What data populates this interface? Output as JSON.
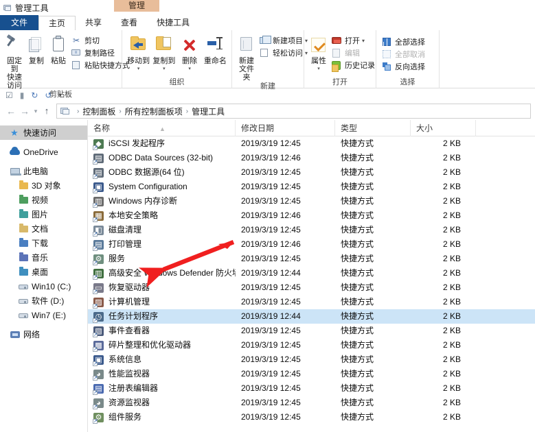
{
  "window": {
    "title": "管理工具",
    "contextual_tab": "管理"
  },
  "tabs": [
    {
      "id": "file",
      "label": "文件"
    },
    {
      "id": "home",
      "label": "主页"
    },
    {
      "id": "share",
      "label": "共享"
    },
    {
      "id": "view",
      "label": "查看"
    },
    {
      "id": "tools",
      "label": "快捷工具"
    }
  ],
  "ribbon": {
    "groups": [
      {
        "id": "clipboard",
        "label": "剪贴板",
        "big": [
          {
            "id": "pin-to-quick-access",
            "label": "固定到\n快速访问",
            "icon": "pin-icon"
          },
          {
            "id": "copy",
            "label": "复制",
            "icon": "copy-icon"
          },
          {
            "id": "paste",
            "label": "粘贴",
            "icon": "paste-icon"
          }
        ],
        "small": [
          {
            "id": "cut",
            "label": "剪切",
            "icon": "scissors-icon"
          },
          {
            "id": "copy-path",
            "label": "复制路径",
            "icon": "copy-path-icon"
          },
          {
            "id": "paste-shortcut",
            "label": "粘贴快捷方式",
            "icon": "paste-shortcut-icon"
          }
        ]
      },
      {
        "id": "organize",
        "label": "组织",
        "big": [
          {
            "id": "move-to",
            "label": "移动到",
            "icon": "move-to-icon",
            "dropdown": true
          },
          {
            "id": "copy-to",
            "label": "复制到",
            "icon": "copy-to-icon",
            "dropdown": true
          },
          {
            "id": "delete",
            "label": "删除",
            "icon": "delete-icon",
            "dropdown": true
          },
          {
            "id": "rename",
            "label": "重命名",
            "icon": "rename-icon"
          }
        ]
      },
      {
        "id": "new",
        "label": "新建",
        "big": [
          {
            "id": "new-folder",
            "label": "新建\n文件夹",
            "icon": "new-folder-icon"
          }
        ],
        "small": [
          {
            "id": "new-item",
            "label": "新建项目",
            "icon": "new-item-icon",
            "dropdown": true
          },
          {
            "id": "easy-access",
            "label": "轻松访问",
            "icon": "easy-access-icon",
            "dropdown": true
          }
        ]
      },
      {
        "id": "open",
        "label": "打开",
        "big": [
          {
            "id": "properties",
            "label": "属性",
            "icon": "properties-icon",
            "dropdown": true
          }
        ],
        "small": [
          {
            "id": "open",
            "label": "打开",
            "icon": "open-icon",
            "dropdown": true
          },
          {
            "id": "edit",
            "label": "编辑",
            "icon": "edit-icon",
            "disabled": true
          },
          {
            "id": "history",
            "label": "历史记录",
            "icon": "history-icon"
          }
        ]
      },
      {
        "id": "select",
        "label": "选择",
        "small": [
          {
            "id": "select-all",
            "label": "全部选择",
            "icon": "select-all-icon"
          },
          {
            "id": "select-none",
            "label": "全部取消",
            "icon": "select-none-icon",
            "disabled": true
          },
          {
            "id": "invert-selection",
            "label": "反向选择",
            "icon": "invert-selection-icon"
          }
        ]
      }
    ]
  },
  "quick_access_toolbar": {
    "items": [
      {
        "id": "properties",
        "icon": "properties-small-icon"
      },
      {
        "id": "new-folder",
        "icon": "new-folder-small-icon"
      },
      {
        "id": "redo",
        "icon": "redo-icon"
      },
      {
        "id": "undo",
        "icon": "undo-icon"
      },
      {
        "id": "customize",
        "icon": "chevron-down-icon"
      }
    ]
  },
  "navigation": {
    "back": "←",
    "forward": "→",
    "recent": "⌄",
    "up": "↑",
    "breadcrumbs": [
      "控制面板",
      "所有控制面板项",
      "管理工具"
    ],
    "separator": "›"
  },
  "sidebar": {
    "items": [
      {
        "id": "quick-access",
        "label": "快速访问",
        "icon": "star-icon",
        "indent": false,
        "selected": true
      },
      {
        "id": "gap1",
        "type": "gap"
      },
      {
        "id": "onedrive",
        "label": "OneDrive",
        "icon": "cloud-icon",
        "indent": false
      },
      {
        "id": "gap2",
        "type": "gap"
      },
      {
        "id": "this-pc",
        "label": "此电脑",
        "icon": "pc-icon",
        "indent": false
      },
      {
        "id": "3d-objects",
        "label": "3D 对象",
        "icon": "folder-yellow-icon",
        "indent": true
      },
      {
        "id": "videos",
        "label": "视频",
        "icon": "folder-green-icon",
        "indent": true
      },
      {
        "id": "pictures",
        "label": "图片",
        "icon": "folder-teal-icon",
        "indent": true
      },
      {
        "id": "documents",
        "label": "文档",
        "icon": "folder-gold-icon",
        "indent": true
      },
      {
        "id": "downloads",
        "label": "下载",
        "icon": "folder-blue-icon",
        "indent": true
      },
      {
        "id": "music",
        "label": "音乐",
        "icon": "folder-music-icon",
        "indent": true
      },
      {
        "id": "desktop",
        "label": "桌面",
        "icon": "folder-desktop-icon",
        "indent": true
      },
      {
        "id": "win10-c",
        "label": "Win10 (C:)",
        "icon": "drive-windows-icon",
        "indent": true
      },
      {
        "id": "software-d",
        "label": "软件 (D:)",
        "icon": "drive-icon",
        "indent": true
      },
      {
        "id": "win7-e",
        "label": "Win7 (E:)",
        "icon": "drive-icon",
        "indent": true
      },
      {
        "id": "gap3",
        "type": "gap"
      },
      {
        "id": "network",
        "label": "网络",
        "icon": "network-icon",
        "indent": false
      }
    ]
  },
  "file_list": {
    "columns": [
      {
        "id": "name",
        "label": "名称",
        "sorted": true
      },
      {
        "id": "date",
        "label": "修改日期"
      },
      {
        "id": "type",
        "label": "类型"
      },
      {
        "id": "size",
        "label": "大小"
      }
    ],
    "rows": [
      {
        "name": "iSCSI 发起程序",
        "date": "2019/3/19 12:45",
        "type": "快捷方式",
        "size": "2 KB",
        "icon_color": "#4d7a52",
        "glyph": "◆"
      },
      {
        "name": "ODBC Data Sources (32-bit)",
        "date": "2019/3/19 12:46",
        "type": "快捷方式",
        "size": "2 KB",
        "icon_color": "#5f6b78",
        "glyph": "▤"
      },
      {
        "name": "ODBC 数据源(64 位)",
        "date": "2019/3/19 12:45",
        "type": "快捷方式",
        "size": "2 KB",
        "icon_color": "#5f6b78",
        "glyph": "▤"
      },
      {
        "name": "System Configuration",
        "date": "2019/3/19 12:45",
        "type": "快捷方式",
        "size": "2 KB",
        "icon_color": "#3b5a8c",
        "glyph": "▣"
      },
      {
        "name": "Windows 内存诊断",
        "date": "2019/3/19 12:45",
        "type": "快捷方式",
        "size": "2 KB",
        "icon_color": "#6b6b6b",
        "glyph": "▥"
      },
      {
        "name": "本地安全策略",
        "date": "2019/3/19 12:46",
        "type": "快捷方式",
        "size": "2 KB",
        "icon_color": "#8a6b3a",
        "glyph": "▦"
      },
      {
        "name": "磁盘清理",
        "date": "2019/3/19 12:45",
        "type": "快捷方式",
        "size": "2 KB",
        "icon_color": "#7a8a99",
        "glyph": "◧"
      },
      {
        "name": "打印管理",
        "date": "2019/3/19 12:46",
        "type": "快捷方式",
        "size": "2 KB",
        "icon_color": "#5a7a9a",
        "glyph": "▤"
      },
      {
        "name": "服务",
        "date": "2019/3/19 12:45",
        "type": "快捷方式",
        "size": "2 KB",
        "icon_color": "#6f8f7f",
        "glyph": "⚙"
      },
      {
        "name": "高级安全 Windows Defender 防火墙",
        "date": "2019/3/19 12:44",
        "type": "快捷方式",
        "size": "2 KB",
        "icon_color": "#3f6f3f",
        "glyph": "▥"
      },
      {
        "name": "恢复驱动器",
        "date": "2019/3/19 12:45",
        "type": "快捷方式",
        "size": "2 KB",
        "icon_color": "#7a7a8a",
        "glyph": "▭"
      },
      {
        "name": "计算机管理",
        "date": "2019/3/19 12:45",
        "type": "快捷方式",
        "size": "2 KB",
        "icon_color": "#8a5a4a",
        "glyph": "▨"
      },
      {
        "name": "任务计划程序",
        "date": "2019/3/19 12:44",
        "type": "快捷方式",
        "size": "2 KB",
        "icon_color": "#4a6a8a",
        "glyph": "◷",
        "selected": true
      },
      {
        "name": "事件查看器",
        "date": "2019/3/19 12:45",
        "type": "快捷方式",
        "size": "2 KB",
        "icon_color": "#4a5a7a",
        "glyph": "▧"
      },
      {
        "name": "碎片整理和优化驱动器",
        "date": "2019/3/19 12:45",
        "type": "快捷方式",
        "size": "2 KB",
        "icon_color": "#5a6a9a",
        "glyph": "▩"
      },
      {
        "name": "系统信息",
        "date": "2019/3/19 12:45",
        "type": "快捷方式",
        "size": "2 KB",
        "icon_color": "#3b5a8c",
        "glyph": "▣"
      },
      {
        "name": "性能监视器",
        "date": "2019/3/19 12:45",
        "type": "快捷方式",
        "size": "2 KB",
        "icon_color": "#7a8a8a",
        "glyph": "◕"
      },
      {
        "name": "注册表编辑器",
        "date": "2019/3/19 12:45",
        "type": "快捷方式",
        "size": "2 KB",
        "icon_color": "#4a6ab0",
        "glyph": "▤"
      },
      {
        "name": "资源监视器",
        "date": "2019/3/19 12:45",
        "type": "快捷方式",
        "size": "2 KB",
        "icon_color": "#7a8a8a",
        "glyph": "◕"
      },
      {
        "name": "组件服务",
        "date": "2019/3/19 12:45",
        "type": "快捷方式",
        "size": "2 KB",
        "icon_color": "#6f8f5f",
        "glyph": "⚙"
      }
    ]
  },
  "annotation": {
    "type": "arrow",
    "color": "#f01f1f",
    "points_to": "任务计划程序"
  },
  "colors": {
    "accent": "#17508f",
    "selection": "#cce4f7",
    "contextual_tab": "#e8bd9a",
    "annotation": "#f01f1f"
  }
}
